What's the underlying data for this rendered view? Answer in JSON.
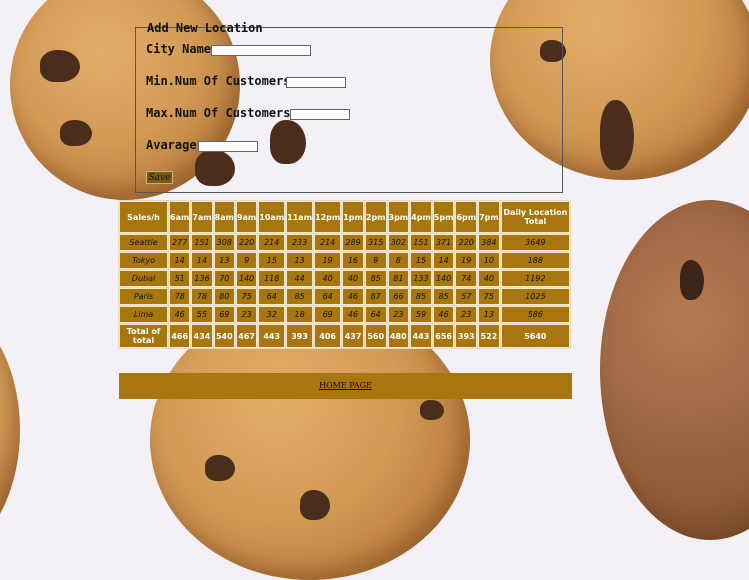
{
  "form": {
    "legend": "Add New Location",
    "city_label": "City Name",
    "min_label": "Min.Num Of Customers",
    "max_label": "Max.Num Of Customers",
    "avg_label": "Avarage",
    "save_label": "Save"
  },
  "table": {
    "headers": [
      "Sales/h",
      "6am",
      "7am",
      "8am",
      "9am",
      "10am",
      "11am",
      "12pm",
      "1pm",
      "2pm",
      "3pm",
      "4pm",
      "5pm",
      "6pm",
      "7pm",
      "Daily Location Total"
    ],
    "rows": [
      {
        "city": "Seattle",
        "values": [
          277,
          151,
          308,
          220,
          214,
          233,
          214,
          289,
          315,
          302,
          151,
          371,
          220,
          384
        ],
        "total": 3649
      },
      {
        "city": "Tokyo",
        "values": [
          14,
          14,
          13,
          9,
          15,
          13,
          19,
          16,
          9,
          8,
          15,
          14,
          19,
          10
        ],
        "total": 188
      },
      {
        "city": "Dubai",
        "values": [
          51,
          136,
          70,
          140,
          118,
          44,
          40,
          40,
          85,
          81,
          133,
          140,
          74,
          40
        ],
        "total": 1192
      },
      {
        "city": "Paris",
        "values": [
          78,
          78,
          80,
          75,
          64,
          85,
          64,
          46,
          87,
          66,
          85,
          85,
          57,
          75
        ],
        "total": 1025
      },
      {
        "city": "Lima",
        "values": [
          46,
          55,
          69,
          23,
          32,
          18,
          69,
          46,
          64,
          23,
          59,
          46,
          23,
          13
        ],
        "total": 586
      }
    ],
    "totals_label": "Total of total",
    "totals": [
      466,
      434,
      540,
      467,
      443,
      393,
      406,
      437,
      560,
      480,
      443,
      656,
      393,
      522
    ],
    "grand_total": 5640
  },
  "nav": {
    "home_label": "HOME PAGE"
  },
  "colors": {
    "accent": "#a8760f",
    "cell_border": "#f0e6cc"
  }
}
